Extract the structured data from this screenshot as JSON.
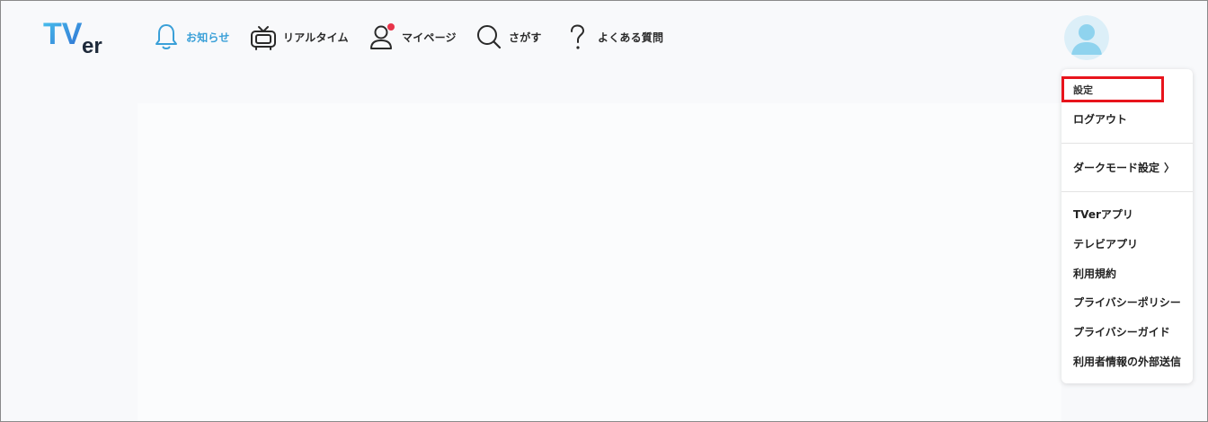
{
  "logo": {
    "text_main": "TV",
    "text_sub": "er",
    "colors": {
      "gradient_start": "#3fb4e6",
      "gradient_end": "#2f6fd0",
      "dark": "#1e2a3a"
    }
  },
  "nav": {
    "items": [
      {
        "label": "お知らせ",
        "icon": "bell-icon",
        "active": true
      },
      {
        "label": "リアルタイム",
        "icon": "tv-icon",
        "active": false
      },
      {
        "label": "マイページ",
        "icon": "user-icon",
        "active": false,
        "badge": true
      },
      {
        "label": "さがす",
        "icon": "search-icon",
        "active": false
      },
      {
        "label": "よくある質問",
        "icon": "question-icon",
        "active": false
      }
    ],
    "active_color": "#3aa0d8",
    "badge_color": "#e8344a"
  },
  "menu": {
    "settings": "設定",
    "logout": "ログアウト",
    "dark_mode": "ダークモード設定",
    "dark_mode_chevron": "〉",
    "links": [
      "TVerアプリ",
      "テレビアプリ",
      "利用規約",
      "プライバシーポリシー",
      "プライバシーガイド",
      "利用者情報の外部送信"
    ]
  },
  "highlight_color": "#e8141c"
}
